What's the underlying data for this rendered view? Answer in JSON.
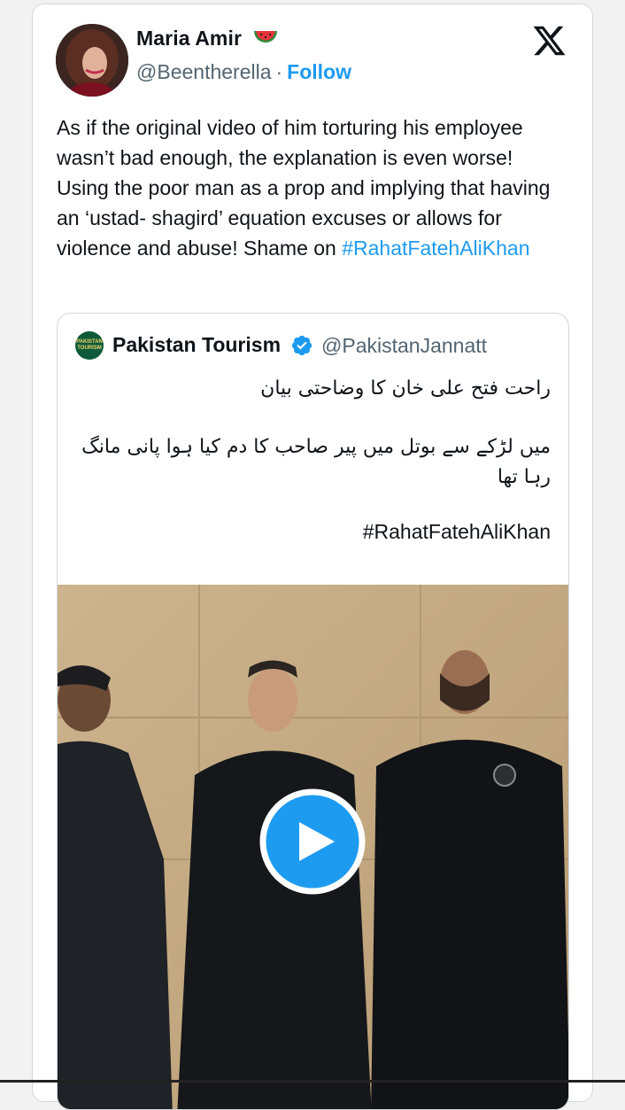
{
  "author": {
    "name": "Maria Amir",
    "emoji_icon": "watermelon-icon",
    "handle": "@Beentherella",
    "separator": "·",
    "follow_label": "Follow"
  },
  "platform_icon": "x-logo-icon",
  "tweet": {
    "text": "As if the original video of him torturing his employee wasn’t bad enough, the explanation is even worse! Using the poor man as a prop and implying that having an ‘ustad- shagird’ equation excuses or allows for violence and abuse! Shame on ",
    "hashtag": "#RahatFatehAliKhan"
  },
  "quoted": {
    "avatar_text": "PAKISTAN TOURISM",
    "name": "Pakistan Tourism",
    "verified_icon": "verified-badge-icon",
    "handle": "@PakistanJannatt",
    "urdu_line1": "راحت فتح علی خان کا وضاحتی بیان",
    "urdu_line2": "میں لڑکے سے بوتل میں پیر صاحب کا دم کیا ہوا پانی مانگ رہا تھا",
    "hashtag": "#RahatFatehAliKhan",
    "media": {
      "type": "video",
      "play_icon": "play-icon"
    }
  },
  "colors": {
    "accent": "#1d9bf0",
    "text": "#0f1419",
    "muted": "#536471",
    "border": "#cfd9de"
  }
}
